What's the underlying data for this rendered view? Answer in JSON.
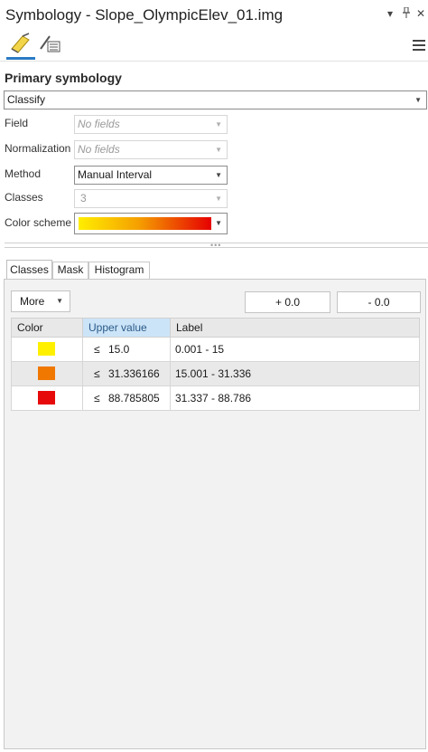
{
  "window": {
    "title": "Symbology - Slope_OlympicElev_01.img"
  },
  "section": {
    "title": "Primary symbology"
  },
  "renderer": {
    "value": "Classify"
  },
  "fields": {
    "field": {
      "label": "Field",
      "value": "No fields"
    },
    "normalization": {
      "label": "Normalization",
      "value": "No fields"
    },
    "method": {
      "label": "Method",
      "value": "Manual Interval"
    },
    "classes": {
      "label": "Classes",
      "value": "3"
    },
    "color_scheme": {
      "label": "Color scheme",
      "colors": [
        "#ffee00",
        "#f5a000",
        "#e60000"
      ]
    }
  },
  "tabs": [
    {
      "label": "Classes",
      "active": true
    },
    {
      "label": "Mask",
      "active": false
    },
    {
      "label": "Histogram",
      "active": false
    }
  ],
  "toolbar": {
    "more_label": "More",
    "plus_label": "+ 0.0",
    "minus_label": "- 0.0"
  },
  "grid": {
    "headers": {
      "color": "Color",
      "upper": "Upper value",
      "label": "Label"
    },
    "rows": [
      {
        "color": "#fff000",
        "le": "≤",
        "upper": "15.0",
        "label": "0.001 - 15"
      },
      {
        "color": "#f07800",
        "le": "≤",
        "upper": "31.336166",
        "label": "15.001 - 31.336"
      },
      {
        "color": "#e60a0a",
        "le": "≤",
        "upper": "88.785805",
        "label": "31.337 - 88.786"
      }
    ]
  },
  "icons": {
    "primary_symbology": "paintbrush-icon",
    "vary_symbology": "brush-list-icon",
    "menu": "hamburger-icon",
    "dropdown": "caret-down-icon",
    "pin": "pin-icon",
    "close": "close-icon"
  }
}
